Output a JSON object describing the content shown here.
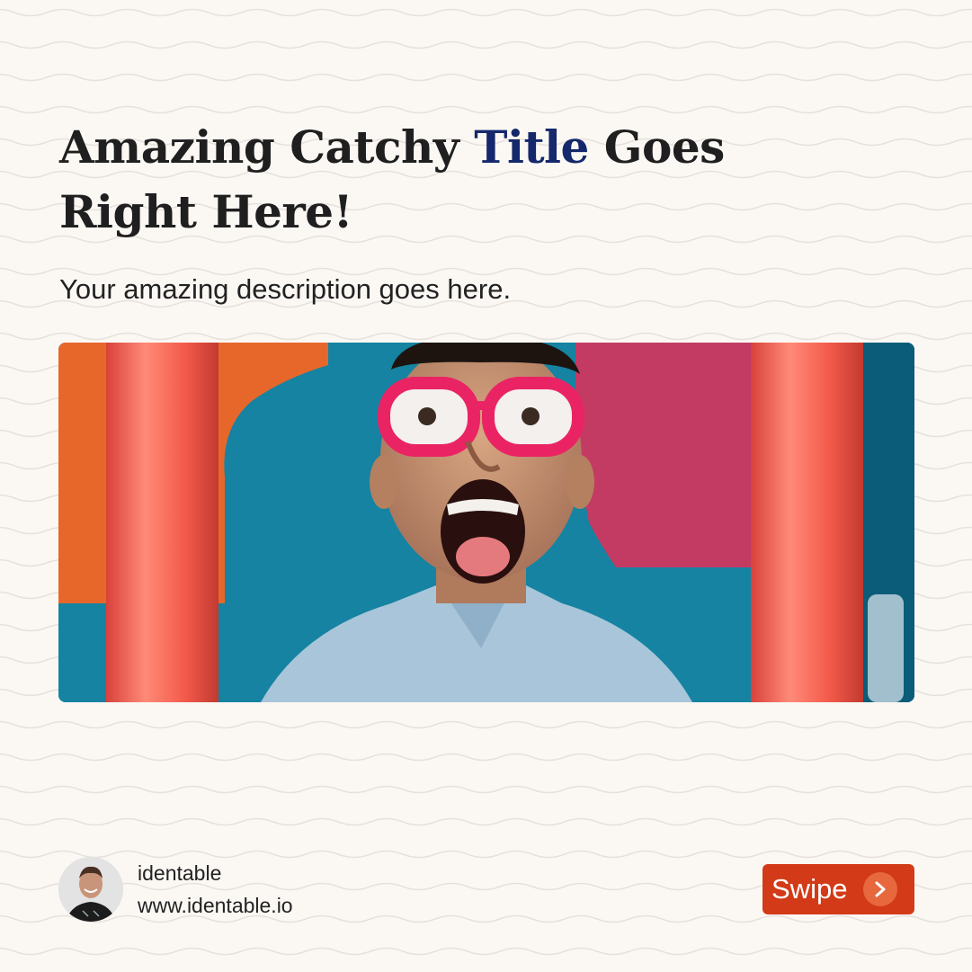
{
  "colors": {
    "background": "#fbf8f4",
    "headline": "#1f1f1f",
    "accent": "#14286b",
    "button": "#d33a17"
  },
  "headline": {
    "before": "Amazing Catchy ",
    "highlight": "Title",
    "after": " Goes Right Here!"
  },
  "description": "Your amazing description goes here.",
  "author": {
    "name": "identable",
    "website": "www.identable.io"
  },
  "swipe": {
    "label": "Swipe",
    "icon": "chevron-right-icon"
  }
}
